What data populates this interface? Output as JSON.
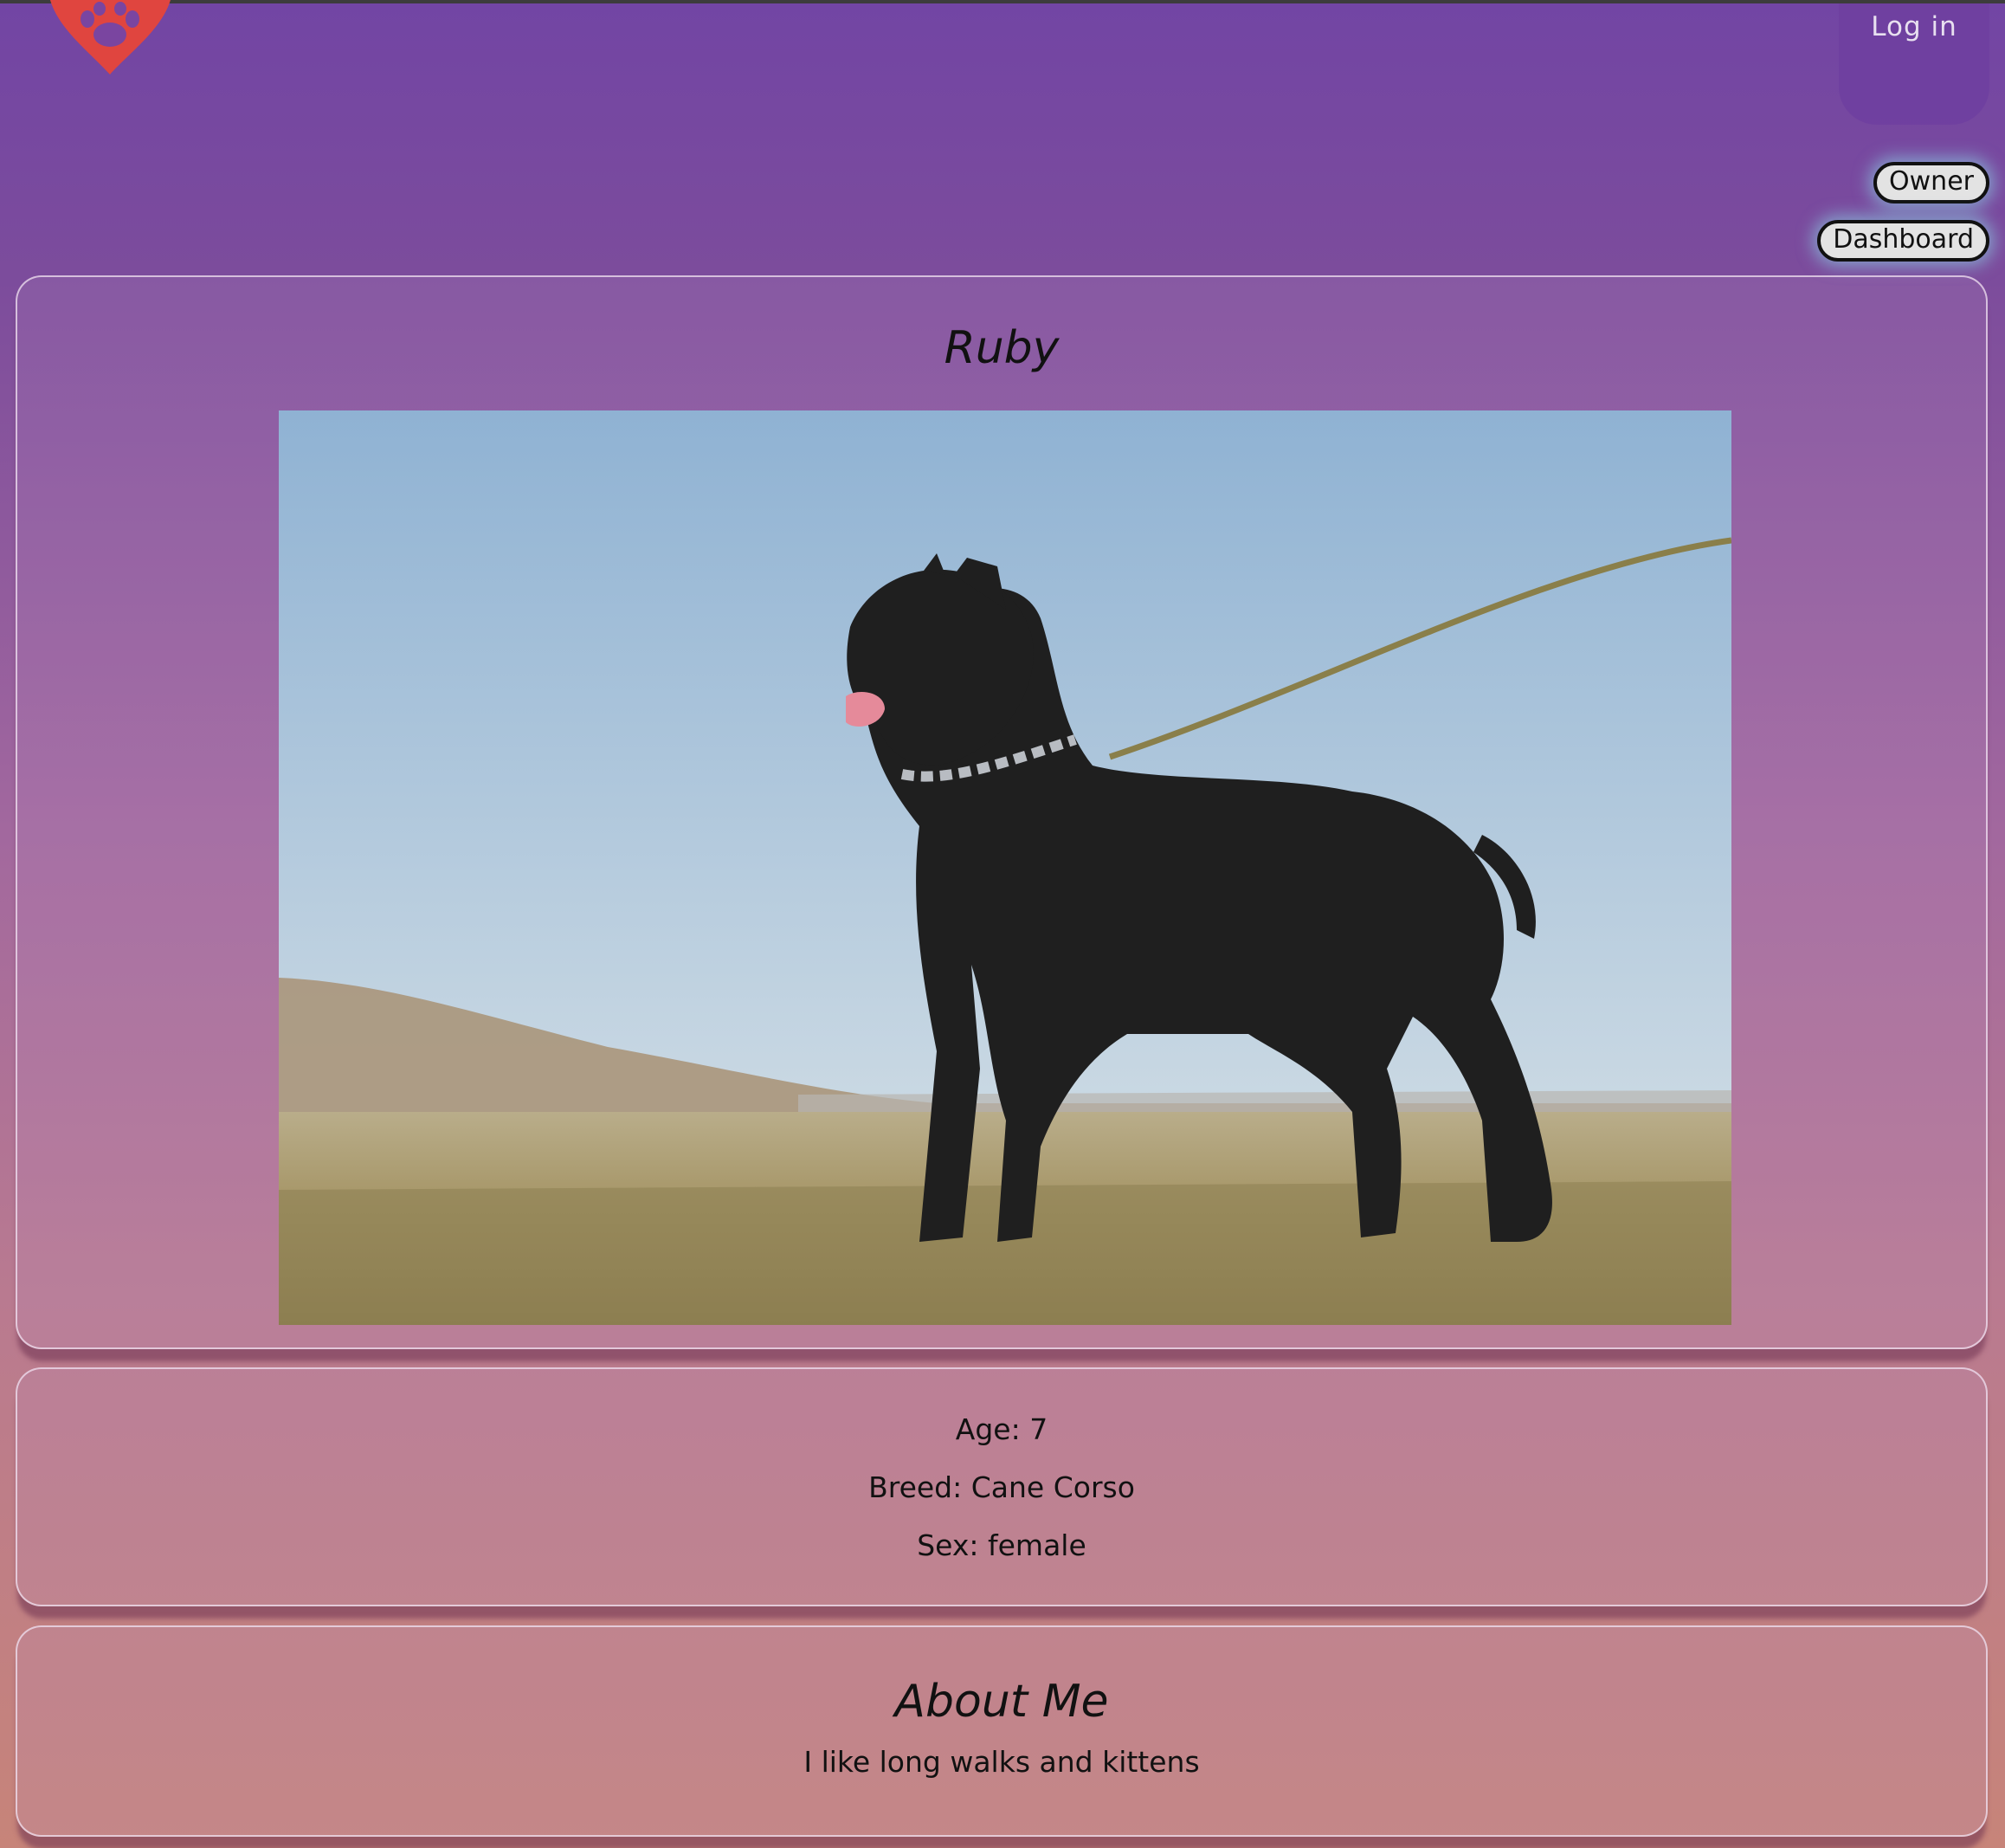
{
  "header": {
    "login_label": "Log in",
    "owner_label": "Owner",
    "dashboard_label": "Dashboard",
    "logo_icon": "paw-heart-icon"
  },
  "pet": {
    "name": "Ruby",
    "photo_icon": "dog-photo",
    "age_line": "Age: 7",
    "breed_line": "Breed: Cane Corso",
    "sex_line": "Sex: female"
  },
  "about": {
    "title": "About Me",
    "text": "I like long walks and kittens"
  },
  "colors": {
    "logo_red": "#e0453f",
    "gradient_top": "#7245a4",
    "gradient_bottom": "#c78479"
  }
}
